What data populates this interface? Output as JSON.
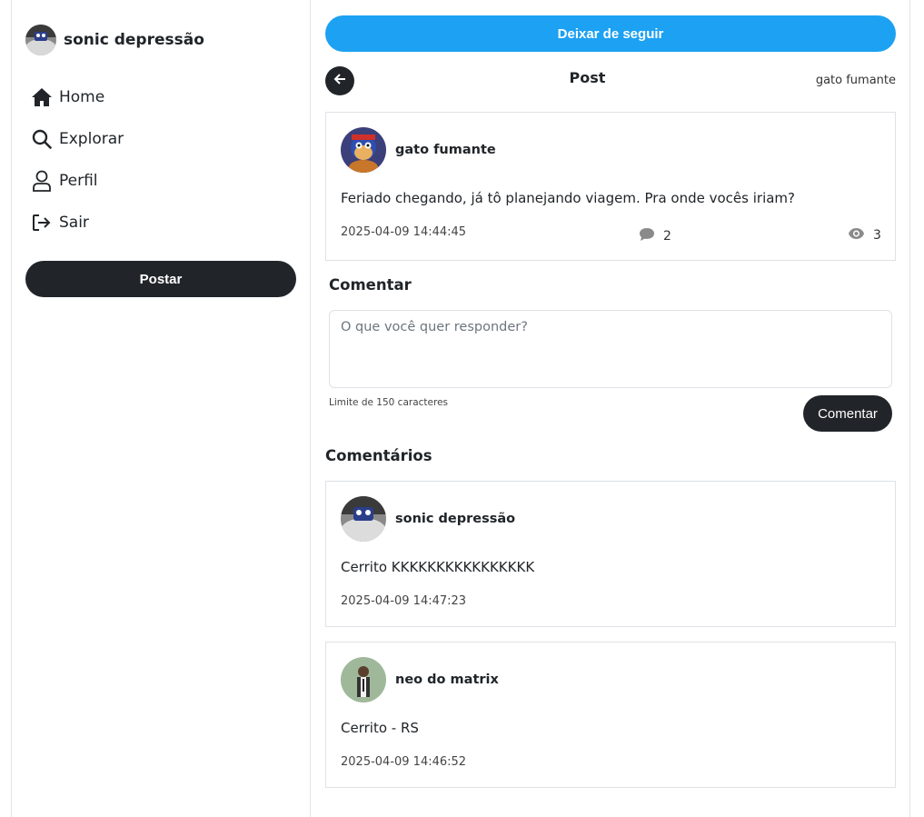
{
  "sidebar": {
    "profile_name": "sonic depressão",
    "nav": [
      {
        "label": "Home",
        "icon": "home-icon"
      },
      {
        "label": "Explorar",
        "icon": "search-icon"
      },
      {
        "label": "Perfil",
        "icon": "user-icon"
      },
      {
        "label": "Sair",
        "icon": "logout-icon"
      }
    ],
    "post_button": "Postar"
  },
  "main": {
    "unfollow_button": "Deixar de seguir",
    "header": {
      "title": "Post",
      "username": "gato fumante"
    },
    "post": {
      "username": "gato fumante",
      "text": "Feriado chegando, já tô planejando viagem. Pra onde vocês iriam?",
      "date": "2025-04-09 14:44:45",
      "comments_count": "2",
      "views_count": "3"
    },
    "comment_form": {
      "title": "Comentar",
      "placeholder": "O que você quer responder?",
      "limit": "Limite de 150 caracteres",
      "submit": "Comentar"
    },
    "comments_title": "Comentários",
    "comments": [
      {
        "username": "sonic depressão",
        "text": "Cerrito KKKKKKKKKKKKKKKK",
        "date": "2025-04-09 14:47:23"
      },
      {
        "username": "neo do matrix",
        "text": "Cerrito - RS",
        "date": "2025-04-09 14:46:52"
      }
    ]
  },
  "colors": {
    "accent_blue": "#1da1f2",
    "dark": "#212529",
    "border": "#dee2e6"
  }
}
